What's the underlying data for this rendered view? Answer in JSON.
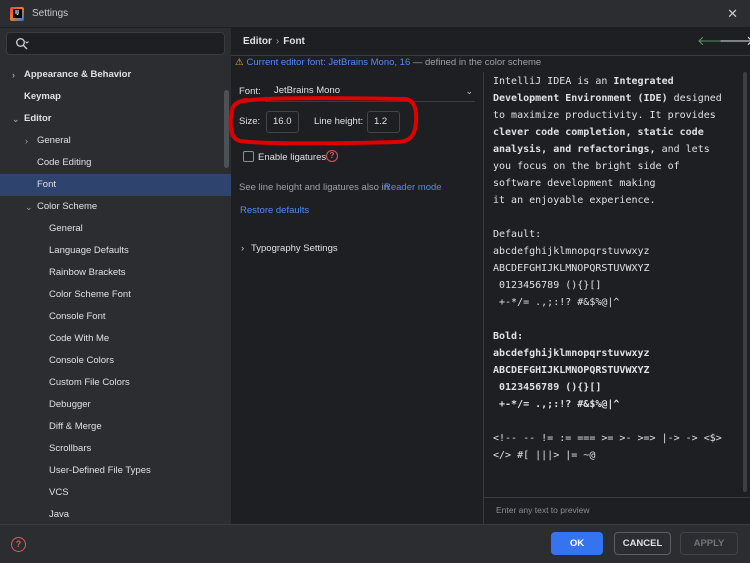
{
  "window": {
    "title": "Settings",
    "close_glyph": "✕",
    "logo_text": "IJ"
  },
  "search": {
    "placeholder": ""
  },
  "sidebar": {
    "items": [
      {
        "label": "Appearance & Behavior",
        "arrow": "›"
      },
      {
        "label": "Keymap"
      },
      {
        "label": "Editor",
        "arrow": "⌄"
      },
      {
        "label": "General",
        "arrow": "›"
      },
      {
        "label": "Code Editing"
      },
      {
        "label": "Font"
      },
      {
        "label": "Color Scheme",
        "arrow": "⌄"
      },
      {
        "label": "General"
      },
      {
        "label": "Language Defaults"
      },
      {
        "label": "Rainbow Brackets"
      },
      {
        "label": "Color Scheme Font"
      },
      {
        "label": "Console Font"
      },
      {
        "label": "Code With Me"
      },
      {
        "label": "Console Colors"
      },
      {
        "label": "Custom File Colors"
      },
      {
        "label": "Debugger"
      },
      {
        "label": "Diff & Merge"
      },
      {
        "label": "Scrollbars"
      },
      {
        "label": "User-Defined File Types"
      },
      {
        "label": "VCS"
      },
      {
        "label": "Java"
      }
    ]
  },
  "header": {
    "breadcrumb": [
      "Editor",
      "Font"
    ],
    "sep": "›",
    "back_glyph": "🡐",
    "forward_glyph": "🡒"
  },
  "notice": {
    "icon": "⚠",
    "link": "Current editor font: JetBrains Mono, 16",
    "rest": " — defined in the color scheme"
  },
  "form": {
    "font_label": "Font:",
    "font_value": "JetBrains Mono",
    "caret": "⌄",
    "size_label": "Size:",
    "size_value": "16.0",
    "line_height_label": "Line height:",
    "line_height_value": "1.2",
    "ligatures_label": "Enable ligatures",
    "help_glyph": "?",
    "hint_text": "See line height and ligatures also in",
    "hint_link": "Reader mode",
    "restore_defaults": "Restore defaults",
    "typography_arrow": "›",
    "typography_label": "Typography Settings"
  },
  "preview": {
    "lines": [
      [
        {
          "t": "IntelliJ IDEA is an "
        },
        {
          "t": "Integrated",
          "b": true
        }
      ],
      [
        {
          "t": "Development Environment (IDE)",
          "b": true
        },
        {
          "t": " designed"
        }
      ],
      [
        {
          "t": "to maximize productivity. It provides"
        }
      ],
      [
        {
          "t": "clever code completion, static code",
          "b": true
        }
      ],
      [
        {
          "t": "analysis, and refactorings,",
          "b": true
        },
        {
          "t": " and lets"
        }
      ],
      [
        {
          "t": "you focus on the bright side of"
        }
      ],
      [
        {
          "t": "software development making"
        }
      ],
      [
        {
          "t": "it an enjoyable experience."
        }
      ],
      [
        {
          "t": ""
        }
      ],
      [
        {
          "t": "Default:"
        }
      ],
      [
        {
          "t": "abcdefghijklmnopqrstuvwxyz"
        }
      ],
      [
        {
          "t": "ABCDEFGHIJKLMNOPQRSTUVWXYZ"
        }
      ],
      [
        {
          "t": " 0123456789 (){}[]"
        }
      ],
      [
        {
          "t": " +-*/= .,;:!? #&$%@|^"
        }
      ],
      [
        {
          "t": ""
        }
      ],
      [
        {
          "t": "Bold:",
          "b": true
        }
      ],
      [
        {
          "t": "abcdefghijklmnopqrstuvwxyz",
          "b": true
        }
      ],
      [
        {
          "t": "ABCDEFGHIJKLMNOPQRSTUVWXYZ",
          "b": true
        }
      ],
      [
        {
          "t": " 0123456789 (){}[]",
          "b": true
        }
      ],
      [
        {
          "t": " +-*/= .,;:!? #&$%@|^",
          "b": true
        }
      ],
      [
        {
          "t": ""
        }
      ],
      [
        {
          "t": "<!-- -- != := === >= >- >=> |-> -> <$>"
        }
      ],
      [
        {
          "t": "</> #[ |||> |= ~@"
        }
      ]
    ],
    "hint": "Enter any text to preview"
  },
  "footer": {
    "help_glyph": "?",
    "ok": "OK",
    "cancel": "CANCEL",
    "apply": "APPLY"
  },
  "colors": {
    "accent": "#3574f0",
    "selection": "#2e436e",
    "link": "#548af7",
    "annotation": "#e00000"
  }
}
